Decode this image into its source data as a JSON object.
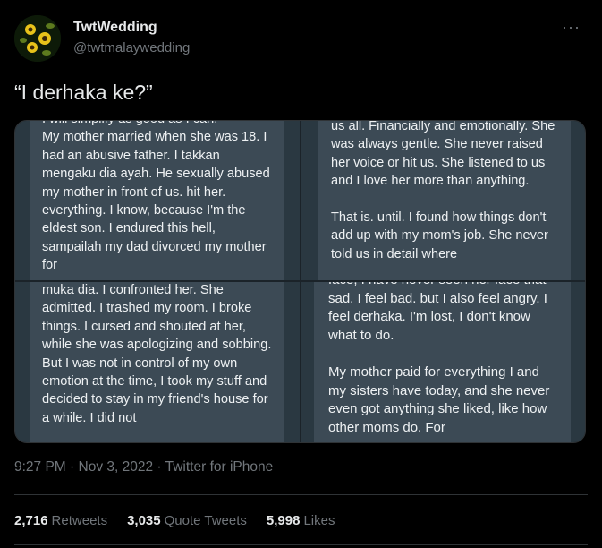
{
  "author": {
    "name": "TwtWedding",
    "handle": "@twtmalaywedding",
    "avatar_icon": "sunflower-avatar-icon"
  },
  "more_icon": "more-options-icon",
  "tweet_text": "“I derhaka ke?”",
  "media": {
    "panel1": "I will simplify as good as I can.\nMy mother married when she was 18. I had an abusive father. I takkan mengaku dia ayah. He sexually abused my mother in front of us. hit her. everything. I know, because I'm the eldest son. I endured this hell, sampailah my dad divorced my mother for",
    "panel2": "us all. Financially and emotionally. She was always gentle. She never raised her voice or hit us. She listened to us and I love her more than anything.\n\nThat is. until. I found how things don't add up with my mom's job. She never told us in detail where",
    "panel3": "muka dia. I confronted her. She admitted. I trashed my room. I broke things. I cursed and shouted at her, while she was apologizing and sobbing. But I was not in control of my own emotion at the time, I took my stuff and decided to stay in my friend's house for a while. I did not",
    "panel4": "face, I have never seen her face that sad. I feel bad. but I also feel angry. I feel derhaka. I'm lost, I don't know what to do.\n\nMy mother paid for everything I and my sisters have today, and she never even got anything she liked, like how other moms do. For"
  },
  "meta": {
    "time": "9:27 PM",
    "date": "Nov 3, 2022",
    "source": "Twitter for iPhone"
  },
  "stats": {
    "retweets_count": "2,716",
    "retweets_label": "Retweets",
    "quotes_count": "3,035",
    "quotes_label": "Quote Tweets",
    "likes_count": "5,998",
    "likes_label": "Likes"
  }
}
